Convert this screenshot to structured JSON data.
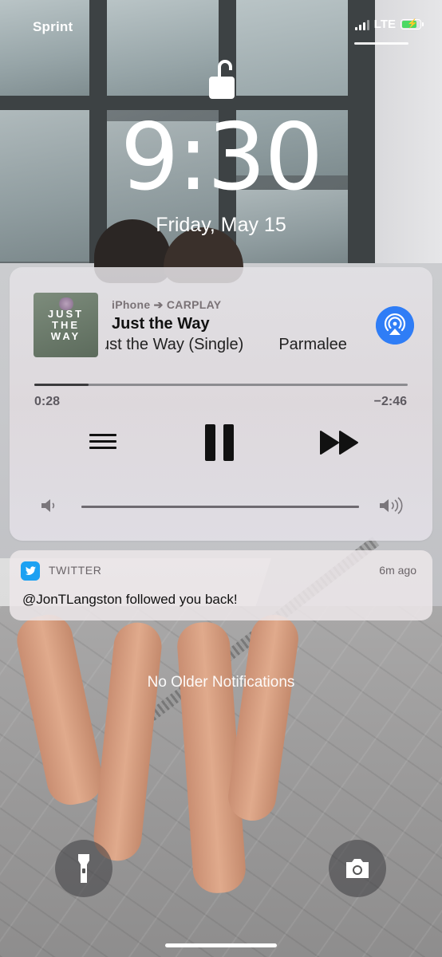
{
  "status_bar": {
    "carrier": "Sprint",
    "network": "LTE",
    "battery_charging": true,
    "battery_color": "#4cd964"
  },
  "lock_screen": {
    "lock_icon": "unlocked-padlock-icon",
    "time": "9:30",
    "date": "Friday, May 15"
  },
  "now_playing": {
    "route": "iPhone ➔ CARPLAY",
    "title": "Just the Way",
    "album": "Just the Way (Single)",
    "artist": "Parmalee",
    "artwork_text_lines": [
      "JUST",
      "THE",
      "WAY"
    ],
    "elapsed": "0:28",
    "remaining": "−2:46",
    "progress": 0.145,
    "volume": 1.0,
    "airplay_color": "#2f7df6",
    "controls": [
      "menu-icon",
      "pause-icon",
      "fast-forward-icon"
    ]
  },
  "notification": {
    "app": "TWITTER",
    "time": "6m ago",
    "body": "@JonTLangston followed you back!",
    "icon": "twitter-bird-icon",
    "icon_color": "#1da1f2"
  },
  "footer": {
    "no_older": "No Older Notifications",
    "left_button_icon": "flashlight-icon",
    "right_button_icon": "camera-icon"
  }
}
